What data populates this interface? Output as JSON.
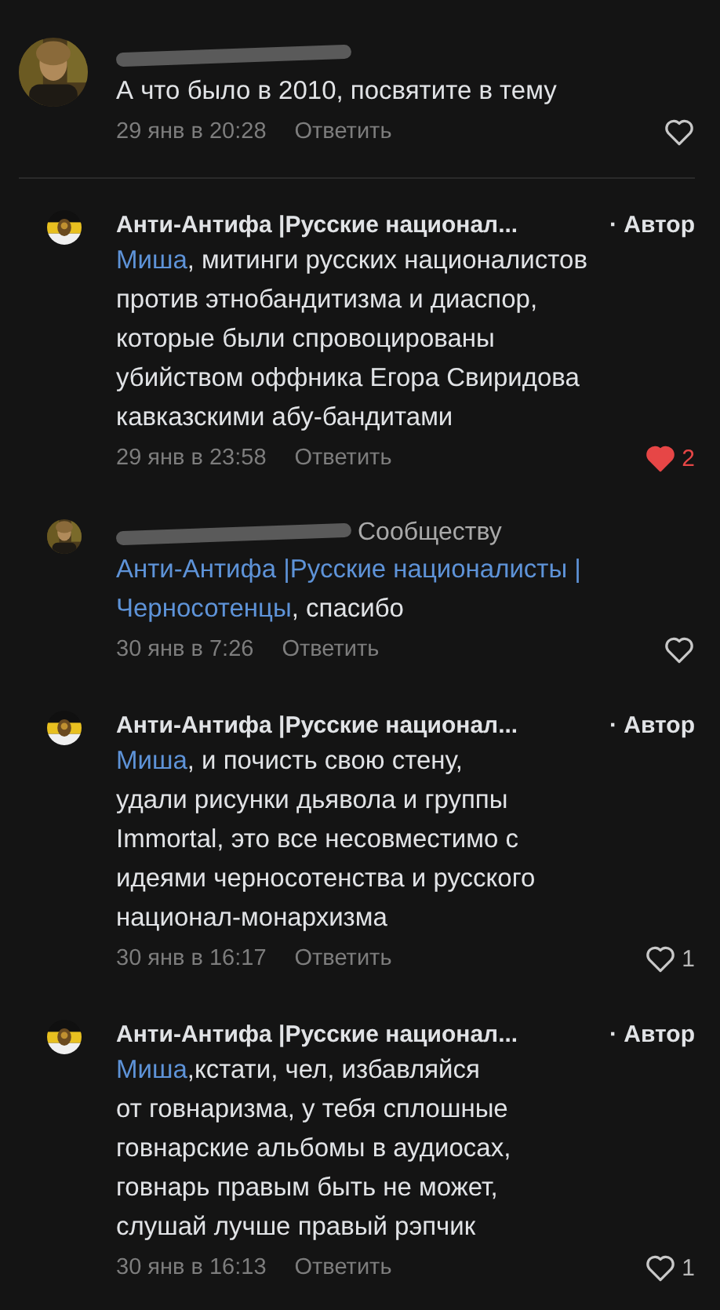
{
  "comments": [
    {
      "kind": "top",
      "avatar": {
        "kind": "picture"
      },
      "author_redacted": true,
      "lines": [
        [
          {
            "text": "А что было в 2010, посвятите в тему",
            "link": false
          }
        ]
      ],
      "date": "29 янв в 20:28",
      "reply_label": "Ответить",
      "likes": {
        "liked": false
      }
    },
    {
      "kind": "reply",
      "avatar": {
        "kind": "logo"
      },
      "author": "Анти-Антифа |Русские национал...",
      "badge": "· Автор",
      "lines": [
        [
          {
            "text": "Миша",
            "link": true
          },
          {
            "text": ", митинги русских националистов",
            "link": false
          }
        ],
        [
          {
            "text": "против этнобандитизма и диаспор,",
            "link": false
          }
        ],
        [
          {
            "text": "которые были спровоцированы",
            "link": false
          }
        ],
        [
          {
            "text": "убийством оффника Егора Свиридова",
            "link": false
          }
        ],
        [
          {
            "text": "кавказскими абу-бандитами",
            "link": false
          }
        ]
      ],
      "date": "29 янв в 23:58",
      "reply_label": "Ответить",
      "likes": {
        "liked": true,
        "count": "2"
      }
    },
    {
      "kind": "reply",
      "avatar": {
        "kind": "picture"
      },
      "author_redacted": true,
      "reply_to": "Сообществу",
      "lines": [
        [
          {
            "text": "Анти-Антифа |Русские националисты |",
            "link": true
          }
        ],
        [
          {
            "text": "Черносотенцы",
            "link": true
          },
          {
            "text": ", спасибо",
            "link": false
          }
        ]
      ],
      "date": "30 янв в 7:26",
      "reply_label": "Ответить",
      "likes": {
        "liked": false
      }
    },
    {
      "kind": "reply",
      "avatar": {
        "kind": "logo"
      },
      "author": "Анти-Антифа |Русские национал...",
      "badge": "· Автор",
      "lines": [
        [
          {
            "text": "Миша",
            "link": true
          },
          {
            "text": ", и почисть свою стену,",
            "link": false
          }
        ],
        [
          {
            "text": "удали рисунки дьявола и группы",
            "link": false
          }
        ],
        [
          {
            "text": "Immortal, это все несовместимо с",
            "link": false
          }
        ],
        [
          {
            "text": "идеями черносотенства и русского",
            "link": false
          }
        ],
        [
          {
            "text": "национал-монархизма",
            "link": false
          }
        ]
      ],
      "date": "30 янв в 16:17",
      "reply_label": "Ответить",
      "likes": {
        "liked": false,
        "count": "1"
      }
    },
    {
      "kind": "reply",
      "avatar": {
        "kind": "logo"
      },
      "author": "Анти-Антифа |Русские национал...",
      "badge": "· Автор",
      "lines": [
        [
          {
            "text": "Миша",
            "link": true
          },
          {
            "text": ",кстати, чел, избавляйся",
            "link": false
          }
        ],
        [
          {
            "text": "от говнаризма, у тебя сплошные",
            "link": false
          }
        ],
        [
          {
            "text": "говнарские альбомы в аудиосах,",
            "link": false
          }
        ],
        [
          {
            "text": "говнарь правым быть не может,",
            "link": false
          }
        ],
        [
          {
            "text": "слушай лучше правый рэпчик",
            "link": false
          }
        ]
      ],
      "date": "30 янв в 16:13",
      "reply_label": "Ответить",
      "likes": {
        "liked": false,
        "count": "1"
      }
    }
  ]
}
